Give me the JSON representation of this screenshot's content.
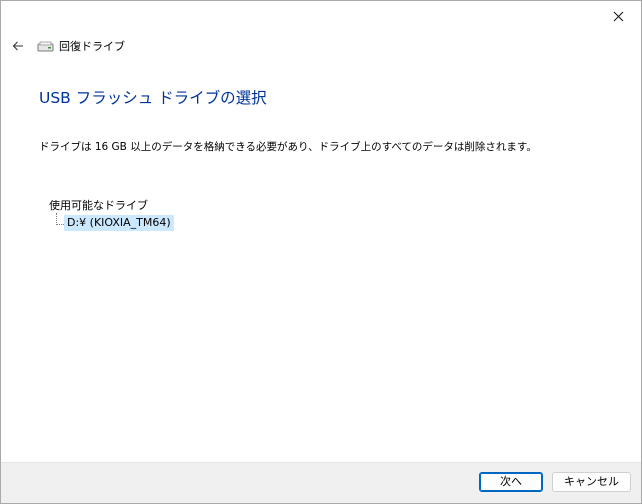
{
  "window": {
    "title": "回復ドライブ"
  },
  "content": {
    "heading": "USB フラッシュ ドライブの選択",
    "description": "ドライブは 16 GB 以上のデータを格納できる必要があり、ドライブ上のすべてのデータは削除されます。"
  },
  "drive_tree": {
    "header": "使用可能なドライブ",
    "items": [
      {
        "label": "D:¥ (KIOXIA_TM64)",
        "selected": true
      }
    ]
  },
  "footer": {
    "next_label": "次へ",
    "cancel_label": "キャンセル"
  },
  "colors": {
    "heading": "#003399",
    "selection": "#cce8ff",
    "footer_bg": "#f0f0f0",
    "default_button_border": "#0067c0"
  },
  "icons": {
    "close": "close-icon",
    "back": "arrow-left-icon",
    "drive": "drive-icon"
  }
}
